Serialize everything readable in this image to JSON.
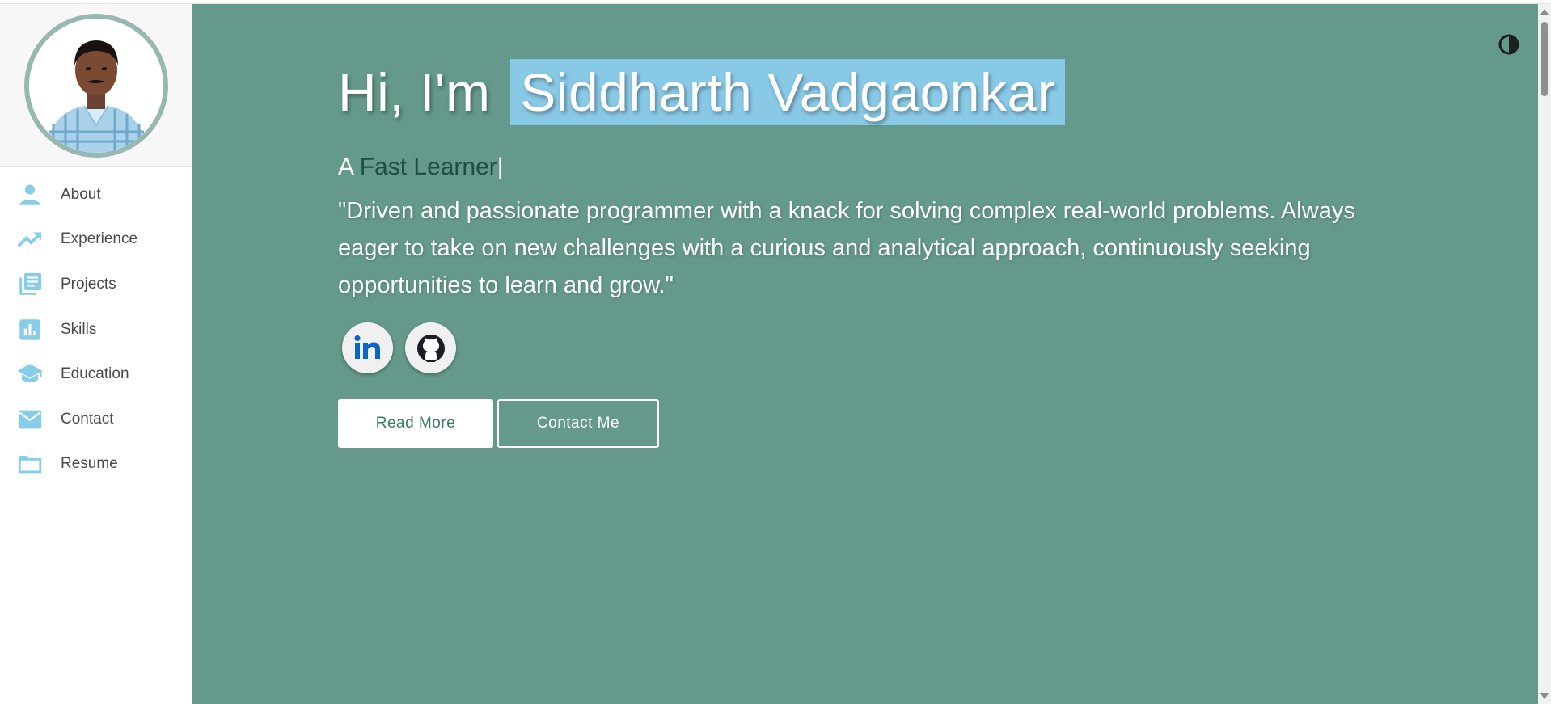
{
  "sidebar": {
    "profile_photo": "profile-photo",
    "items": [
      {
        "label": "About",
        "icon": "person-icon"
      },
      {
        "label": "Experience",
        "icon": "trending-up-icon"
      },
      {
        "label": "Projects",
        "icon": "library-books-icon"
      },
      {
        "label": "Skills",
        "icon": "bar-chart-icon"
      },
      {
        "label": "Education",
        "icon": "school-icon"
      },
      {
        "label": "Contact",
        "icon": "mail-icon"
      },
      {
        "label": "Resume",
        "icon": "folder-icon"
      }
    ]
  },
  "hero": {
    "greeting": "Hi, I'm",
    "name": "Siddharth Vadgaonkar",
    "tagline_prefix": "A",
    "tagline_role": "Fast Learner",
    "tagline_cursor": "|",
    "bio": "\"Driven and passionate programmer with a knack for solving complex real-world problems. Always eager to take on new challenges with a curious and analytical approach, continuously seeking opportunities to learn and grow.\"",
    "socials": [
      {
        "name": "linkedin-icon"
      },
      {
        "name": "github-icon"
      }
    ],
    "read_more_label": "Read More",
    "contact_me_label": "Contact Me"
  },
  "theme_toggle": {
    "icon": "contrast-icon"
  },
  "colors": {
    "hero_background": "#64998b",
    "name_highlight": "#88c9e6",
    "sidebar_icon": "#87cde8",
    "avatar_border": "#97b8b1",
    "role_text": "#1f4f43"
  }
}
